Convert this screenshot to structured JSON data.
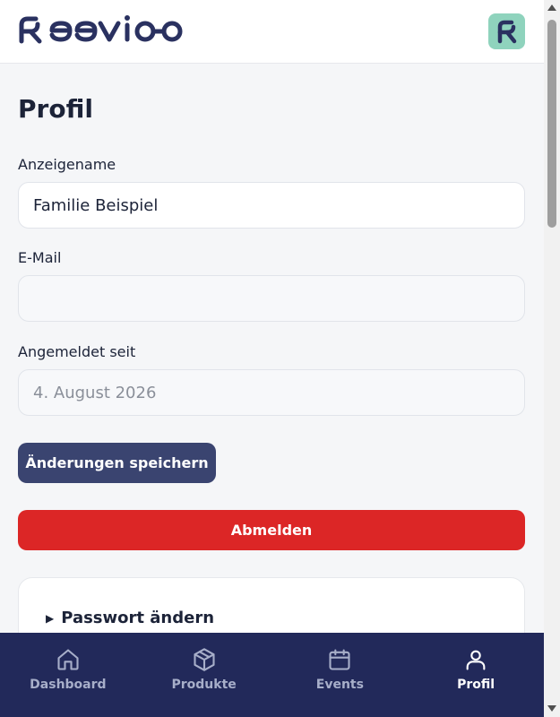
{
  "header": {
    "logo_text": "keevioo",
    "avatar_letter": "R",
    "colors": {
      "avatar_bg": "#8fd3bd",
      "logo": "#2a3160"
    }
  },
  "page": {
    "title": "Profil",
    "fields": {
      "display_name": {
        "label": "Anzeigename",
        "value": "Familie Beispiel"
      },
      "email": {
        "label": "E-Mail",
        "value": ""
      },
      "member_since": {
        "label": "Angemeldet seit",
        "value": "4. August 2026"
      }
    },
    "save_label": "Änderungen speichern",
    "logout_label": "Abmelden",
    "password_section": {
      "label": "Passwort ändern"
    }
  },
  "nav": {
    "items": [
      {
        "label": "Dashboard",
        "icon": "home-icon"
      },
      {
        "label": "Produkte",
        "icon": "package-icon"
      },
      {
        "label": "Events",
        "icon": "calendar-icon"
      },
      {
        "label": "Profil",
        "icon": "user-icon",
        "active": true
      }
    ]
  },
  "colors": {
    "primary": "#3a4470",
    "danger": "#dc2626",
    "nav_bg": "#22295a"
  }
}
